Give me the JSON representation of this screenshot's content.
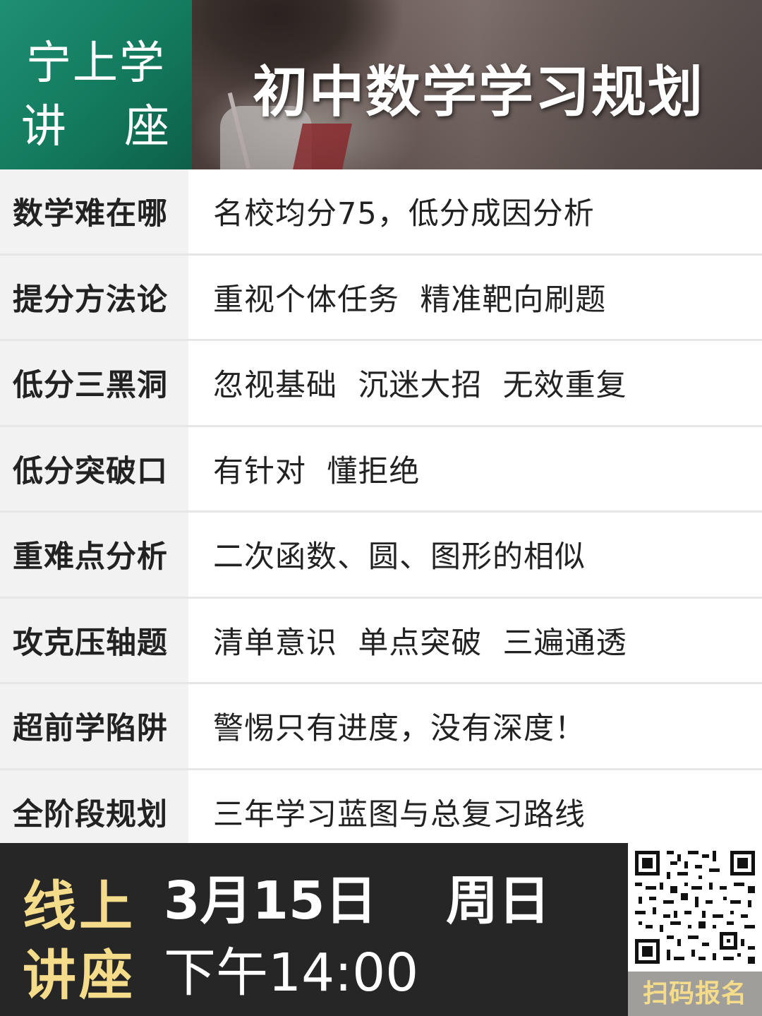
{
  "header": {
    "brand_line1": "宁上学",
    "brand_line2_a": "讲",
    "brand_line2_b": "座",
    "title": "初中数学学习规划"
  },
  "rows": [
    {
      "label": "数学难在哪",
      "desc": "名校均分75，低分成因分析"
    },
    {
      "label": "提分方法论",
      "desc": "重视个体任务  精准靶向刷题"
    },
    {
      "label": "低分三黑洞",
      "desc": "忽视基础  沉迷大招  无效重复"
    },
    {
      "label": "低分突破口",
      "desc": "有针对  懂拒绝"
    },
    {
      "label": "重难点分析",
      "desc": "二次函数、圆、图形的相似"
    },
    {
      "label": "攻克压轴题",
      "desc": "清单意识  单点突破  三遍通透"
    },
    {
      "label": "超前学陷阱",
      "desc": "警惕只有进度，没有深度！"
    },
    {
      "label": "全阶段规划",
      "desc": "三年学习蓝图与总复习路线"
    }
  ],
  "footer": {
    "online_line1": "线上",
    "online_line2": "讲座",
    "date": "3月15日",
    "weekday": "周日",
    "time": "下午14:00",
    "qr_label": "扫码报名"
  },
  "colors": {
    "brand_green": "#137a5e",
    "footer_bg": "#262626",
    "accent_gold": "#f5dc8b",
    "label_bg": "#f2f2f2"
  }
}
